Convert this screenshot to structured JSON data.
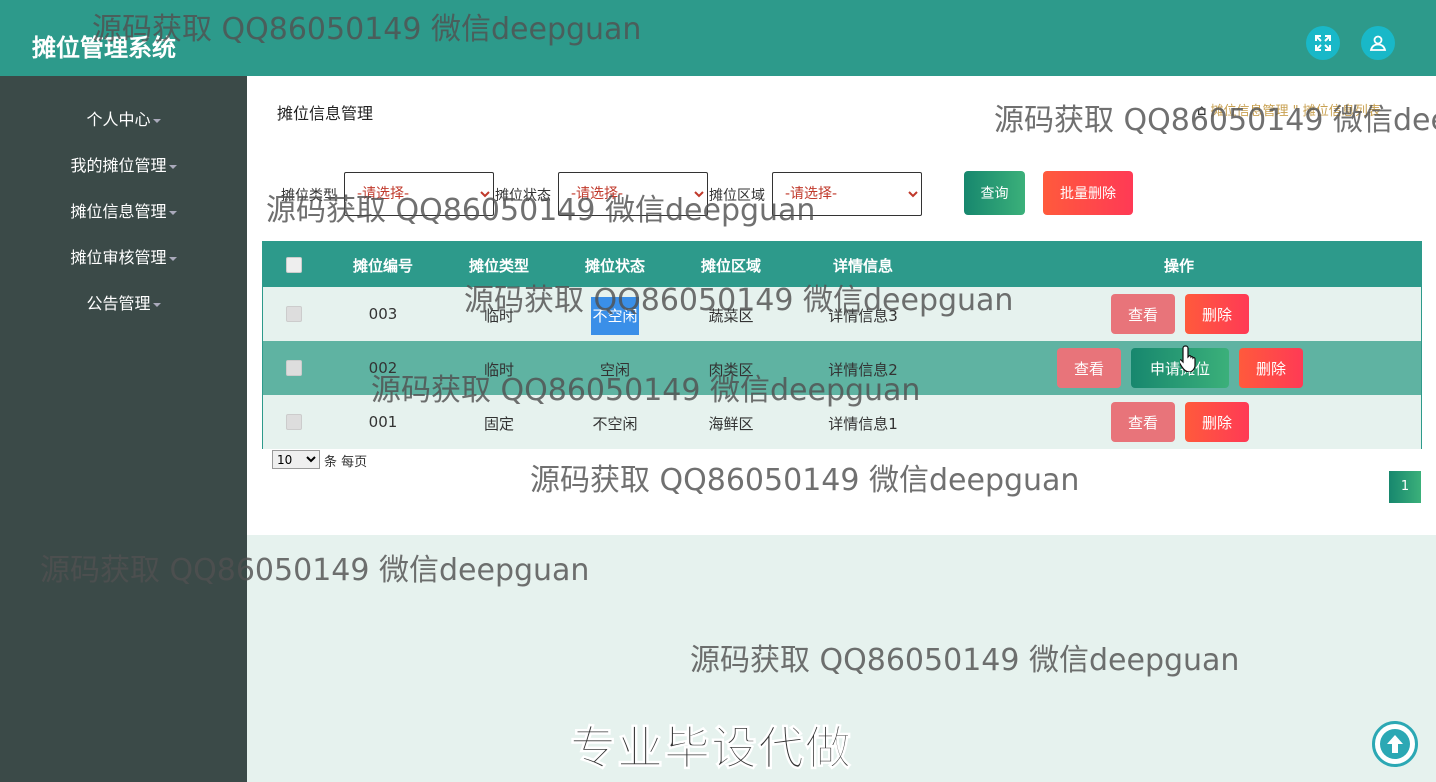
{
  "header": {
    "app_title": "摊位管理系统"
  },
  "sidebar": {
    "items": [
      {
        "label": "个人中心"
      },
      {
        "label": "我的摊位管理"
      },
      {
        "label": "摊位信息管理"
      },
      {
        "label": "摊位审核管理"
      },
      {
        "label": "公告管理"
      }
    ]
  },
  "page": {
    "title": "摊位信息管理",
    "breadcrumb": "摊位信息管理 \" 摊位信息列表"
  },
  "filters": {
    "type_label": "摊位类型",
    "status_label": "摊位状态",
    "area_label": "摊位区域",
    "placeholder": "-请选择-",
    "query_button": "查询",
    "batch_delete_button": "批量删除"
  },
  "table": {
    "columns": [
      "摊位编号",
      "摊位类型",
      "摊位状态",
      "摊位区域",
      "详情信息",
      "操作"
    ],
    "rows": [
      {
        "id": "003",
        "type": "临时",
        "status": "不空闲",
        "area": "蔬菜区",
        "detail": "详情信息3"
      },
      {
        "id": "002",
        "type": "临时",
        "status": "空闲",
        "area": "肉类区",
        "detail": "详情信息2"
      },
      {
        "id": "001",
        "type": "固定",
        "status": "不空闲",
        "area": "海鲜区",
        "detail": "详情信息1"
      }
    ],
    "actions": {
      "view": "查看",
      "delete": "删除",
      "apply": "申请摊位"
    }
  },
  "pagination": {
    "page_size": "10",
    "per_page_text": "条 每页",
    "current_page": "1"
  },
  "watermark": {
    "text": "源码获取 QQ86050149 微信deepguan",
    "slogan": "专业毕设代做"
  },
  "colors": {
    "primary": "#2d9a8b",
    "sidebar": "#3b4a48",
    "danger": "#ff4a48",
    "view": "#e8747a"
  }
}
